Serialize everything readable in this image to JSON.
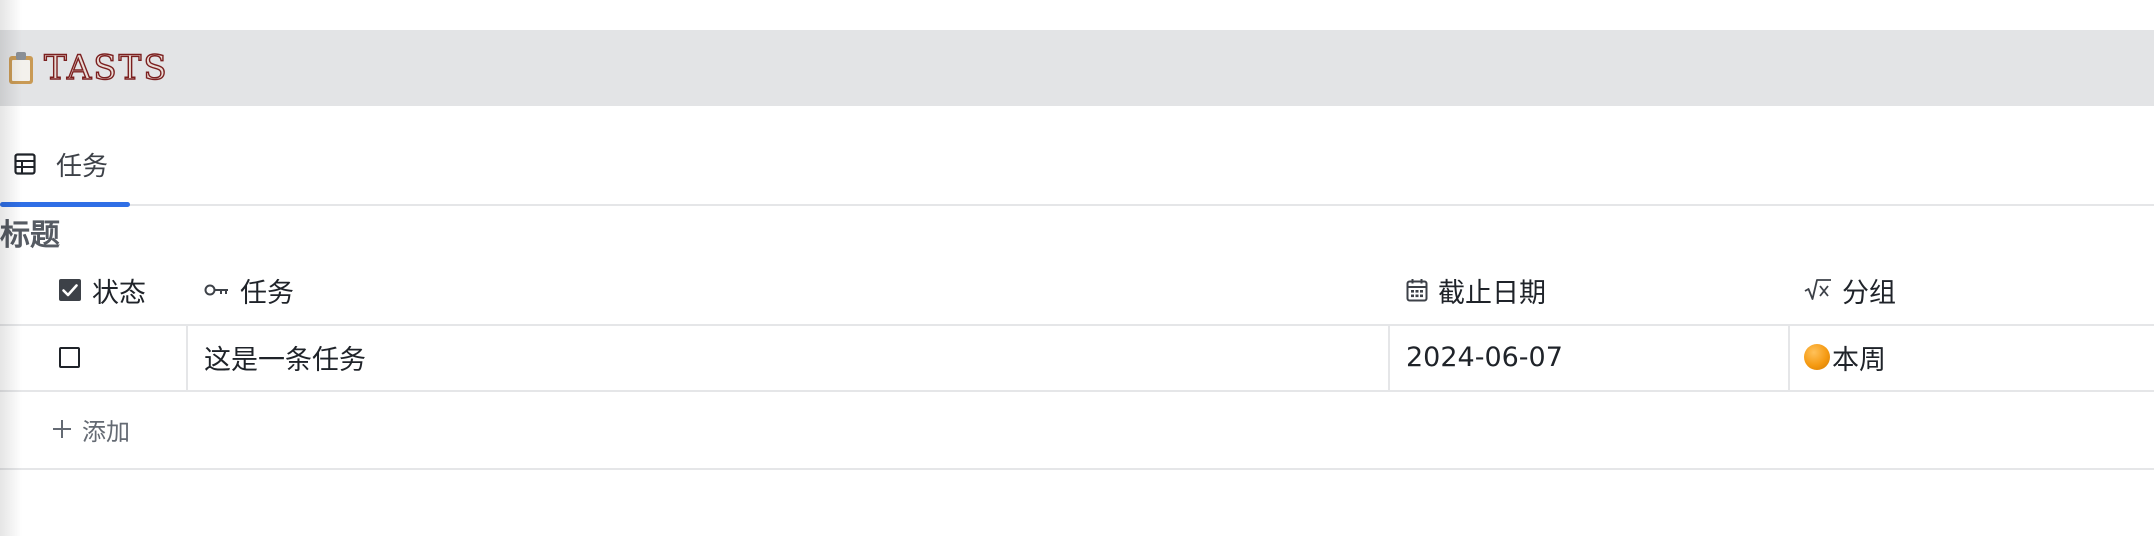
{
  "database": {
    "icon": "clipboard-icon",
    "title": "TASTS"
  },
  "views": {
    "active_tab": {
      "icon": "table-icon",
      "label": "任务"
    },
    "accent_color": "#2f6fe6"
  },
  "section": {
    "title": "标题"
  },
  "table": {
    "columns": [
      {
        "icon": "checkbox-checked-icon",
        "label": "状态"
      },
      {
        "icon": "key-icon",
        "label": "任务"
      },
      {
        "icon": "calendar-icon",
        "label": "截止日期"
      },
      {
        "icon": "formula-icon",
        "label": "分组"
      }
    ],
    "rows": [
      {
        "status": false,
        "task": "这是一条任务",
        "due_date": "2024-06-07",
        "group": "本周",
        "group_icon": "orange-circle-icon"
      }
    ],
    "add_label": "添加"
  }
}
